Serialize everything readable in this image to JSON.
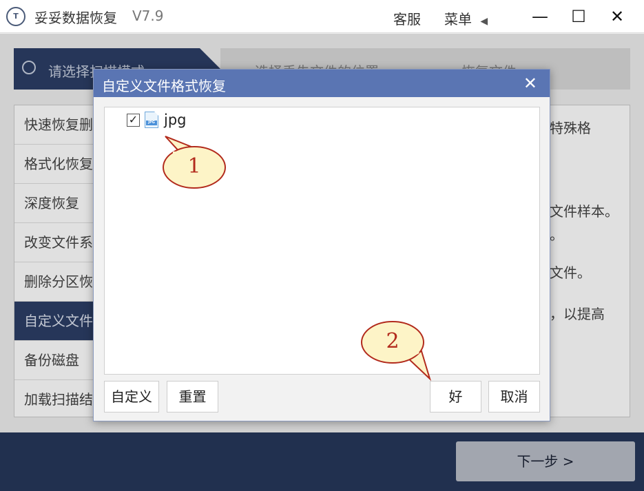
{
  "app": {
    "logo_text": "T",
    "title": "妥妥数据恢复",
    "version": "V7.9",
    "customer_service": "客服",
    "menu": "菜单",
    "menu_arrow": "◀",
    "minimize": "—",
    "maximize": "☐",
    "close": "✕"
  },
  "steps": {
    "step1": "请选择扫描模式",
    "step2": "选择丢失文件的位置",
    "step3": "恢复文件"
  },
  "modes": [
    "快速恢复删除的文件",
    "格式化恢复",
    "深度恢复",
    "改变文件系统恢复",
    "删除分区恢复",
    "自定义文件格式恢复",
    "备份磁盘",
    "加载扫描结果"
  ],
  "description": [
    "特殊格",
    "文件样本。",
    "。",
    "文件。",
    "，以提高"
  ],
  "next_button": "下一步 >",
  "dialog": {
    "title": "自定义文件格式恢复",
    "close": "✕",
    "tree": [
      {
        "label": "jpg",
        "checked": true,
        "icon": "jpg-file-icon",
        "icon_tag": "JPG",
        "check_mark": "✓"
      }
    ],
    "buttons": {
      "custom": "自定义",
      "reset": "重置",
      "ok": "好",
      "cancel": "取消"
    }
  },
  "callouts": {
    "one": "1",
    "two": "2",
    "fill": "#fdf4c7",
    "stroke": "#b22a1c"
  },
  "colors": {
    "dialog_header": "#5a75b3",
    "dark_navy": "#2c3e66",
    "bottom_bar": "#26375a"
  }
}
